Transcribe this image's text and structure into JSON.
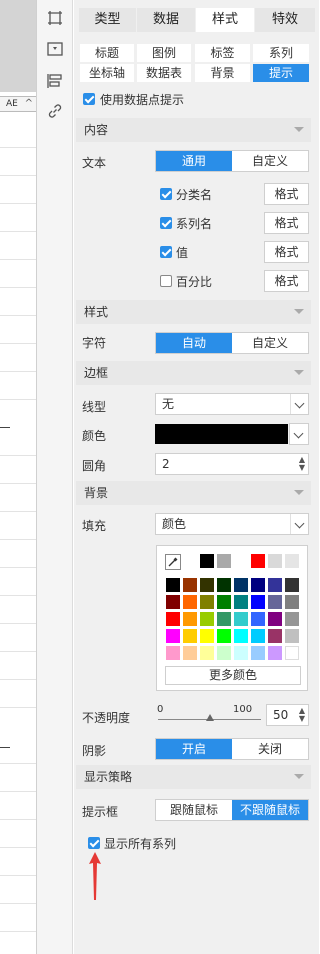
{
  "left_strip": {
    "column_header": "AE",
    "column_header_icon": "chevron-up-icon"
  },
  "top_tabs": [
    "类型",
    "数据",
    "样式",
    "特效"
  ],
  "sub_tabs_row1": [
    "标题",
    "图例",
    "标签",
    "系列"
  ],
  "sub_tabs_row2": [
    "坐标轴",
    "数据表",
    "背景",
    "提示"
  ],
  "use_datapoint_tip": "使用数据点提示",
  "sections": {
    "content": "内容",
    "style": "样式",
    "border": "边框",
    "background": "背景",
    "display_strategy": "显示策略"
  },
  "content": {
    "text_label": "文本",
    "text_options": [
      "通用",
      "自定义"
    ],
    "items": [
      {
        "label": "分类名",
        "checked": true,
        "button": "格式"
      },
      {
        "label": "系列名",
        "checked": true,
        "button": "格式"
      },
      {
        "label": "值",
        "checked": true,
        "button": "格式"
      },
      {
        "label": "百分比",
        "checked": false,
        "button": "格式"
      }
    ]
  },
  "style": {
    "char_label": "字符",
    "char_options": [
      "自动",
      "自定义"
    ]
  },
  "border": {
    "line_label": "线型",
    "line_value": "无",
    "color_label": "颜色",
    "color_value": "#000000",
    "radius_label": "圆角",
    "radius_value": "2"
  },
  "background": {
    "fill_label": "填充",
    "fill_value": "颜色",
    "recent_colors": [
      "#000000",
      "#a9a9a9",
      "#ffffff",
      "#ff0000",
      "#d9d9d9",
      "#e5e5e5"
    ],
    "palette": [
      [
        "#000000",
        "#993300",
        "#333300",
        "#003300",
        "#003366",
        "#000080",
        "#333399",
        "#333333"
      ],
      [
        "#800000",
        "#ff6600",
        "#808000",
        "#008000",
        "#008080",
        "#0000ff",
        "#666699",
        "#808080"
      ],
      [
        "#ff0000",
        "#ff9900",
        "#99cc00",
        "#339966",
        "#33cccc",
        "#3366ff",
        "#800080",
        "#969696"
      ],
      [
        "#ff00ff",
        "#ffcc00",
        "#ffff00",
        "#00ff00",
        "#00ffff",
        "#00ccff",
        "#993366",
        "#c0c0c0"
      ],
      [
        "#ff99cc",
        "#ffcc99",
        "#ffff99",
        "#ccffcc",
        "#ccffff",
        "#99ccff",
        "#cc99ff",
        "#ffffff"
      ]
    ],
    "more_colors": "更多颜色",
    "opacity_label": "不透明度",
    "opacity_min": "0",
    "opacity_max": "100",
    "opacity_value": "50",
    "shadow_label": "阴影",
    "shadow_options": [
      "开启",
      "关闭"
    ]
  },
  "display_strategy": {
    "tipbox_label": "提示框",
    "tipbox_options": [
      "跟随鼠标",
      "不跟随鼠标"
    ],
    "show_all_series": "显示所有系列"
  },
  "colors": {
    "accent": "#2a8ee8",
    "annotation_arrow": "#e53935"
  }
}
